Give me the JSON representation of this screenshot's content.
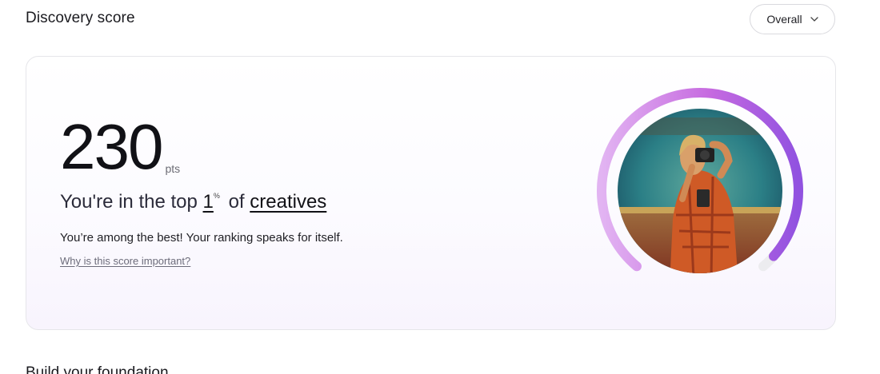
{
  "header": {
    "title": "Discovery score",
    "filter_label": "Overall"
  },
  "score_card": {
    "score": "230",
    "unit": "pts",
    "rank_prefix": "You're in the top",
    "rank_value": "1",
    "rank_unit": "%",
    "rank_of": "of",
    "rank_group": "creatives",
    "description": "You’re among the best! Your ranking speaks for itself.",
    "info_link": "Why is this score important?",
    "progress_fraction": 0.97
  },
  "next_section": {
    "title": "Build your foundation"
  },
  "colors": {
    "gauge_start": "#e2b4f2",
    "gauge_mid": "#c66ae0",
    "gauge_end": "#9152e0",
    "gauge_track": "#ececef"
  },
  "icons": {
    "filter_dropdown": "chevron-down-icon",
    "avatar": "profile-photo"
  }
}
